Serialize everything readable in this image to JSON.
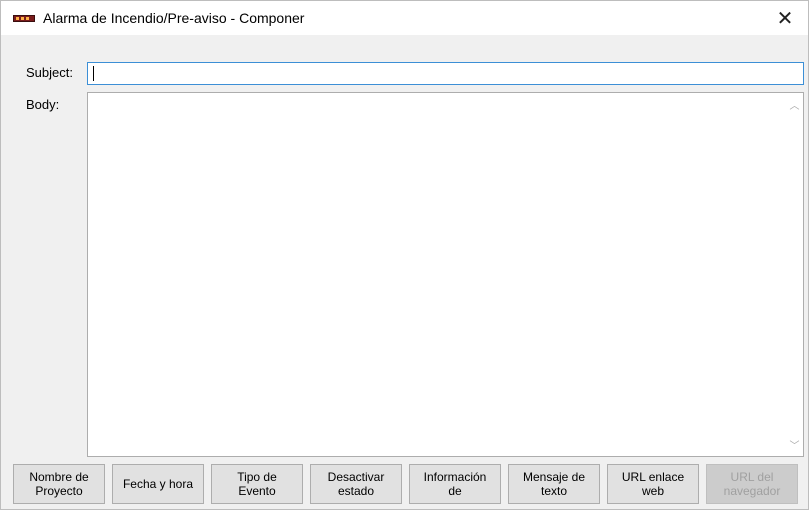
{
  "window": {
    "title": "Alarma de Incendio/Pre-aviso - Componer",
    "close_label": "✕"
  },
  "form": {
    "subject_label": "Subject:",
    "subject_value": "",
    "body_label": "Body:",
    "body_value": ""
  },
  "scrollbar": {
    "up_glyph": "︿",
    "down_glyph": "﹀"
  },
  "buttons": [
    {
      "label": "Nombre de\nProyecto",
      "enabled": true
    },
    {
      "label": "Fecha y hora",
      "enabled": true
    },
    {
      "label": "Tipo de\nEvento",
      "enabled": true
    },
    {
      "label": "Desactivar\nestado",
      "enabled": true
    },
    {
      "label": "Información\nde",
      "enabled": true
    },
    {
      "label": "Mensaje de\ntexto",
      "enabled": true
    },
    {
      "label": "URL enlace\nweb",
      "enabled": true
    },
    {
      "label": "URL del\nnavegador",
      "enabled": false
    }
  ],
  "colors": {
    "focus_border": "#3c8fd6",
    "app_icon": "#7a1c1c"
  }
}
